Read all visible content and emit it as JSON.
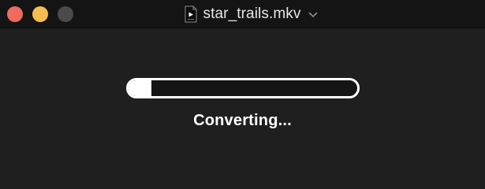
{
  "window": {
    "title": "star_trails.mkv",
    "file_icon": "video-file-icon",
    "chevron_icon": "chevron-down-icon",
    "traffic_lights": {
      "close_color": "#ee6b5e",
      "minimize_color": "#f5be4f",
      "zoom_color": "#4a4a4a"
    }
  },
  "conversion": {
    "status_text": "Converting...",
    "progress": 0.1
  },
  "colors": {
    "background": "#1f1f1f",
    "titlebar": "#141414",
    "progress": "#ffffff"
  }
}
